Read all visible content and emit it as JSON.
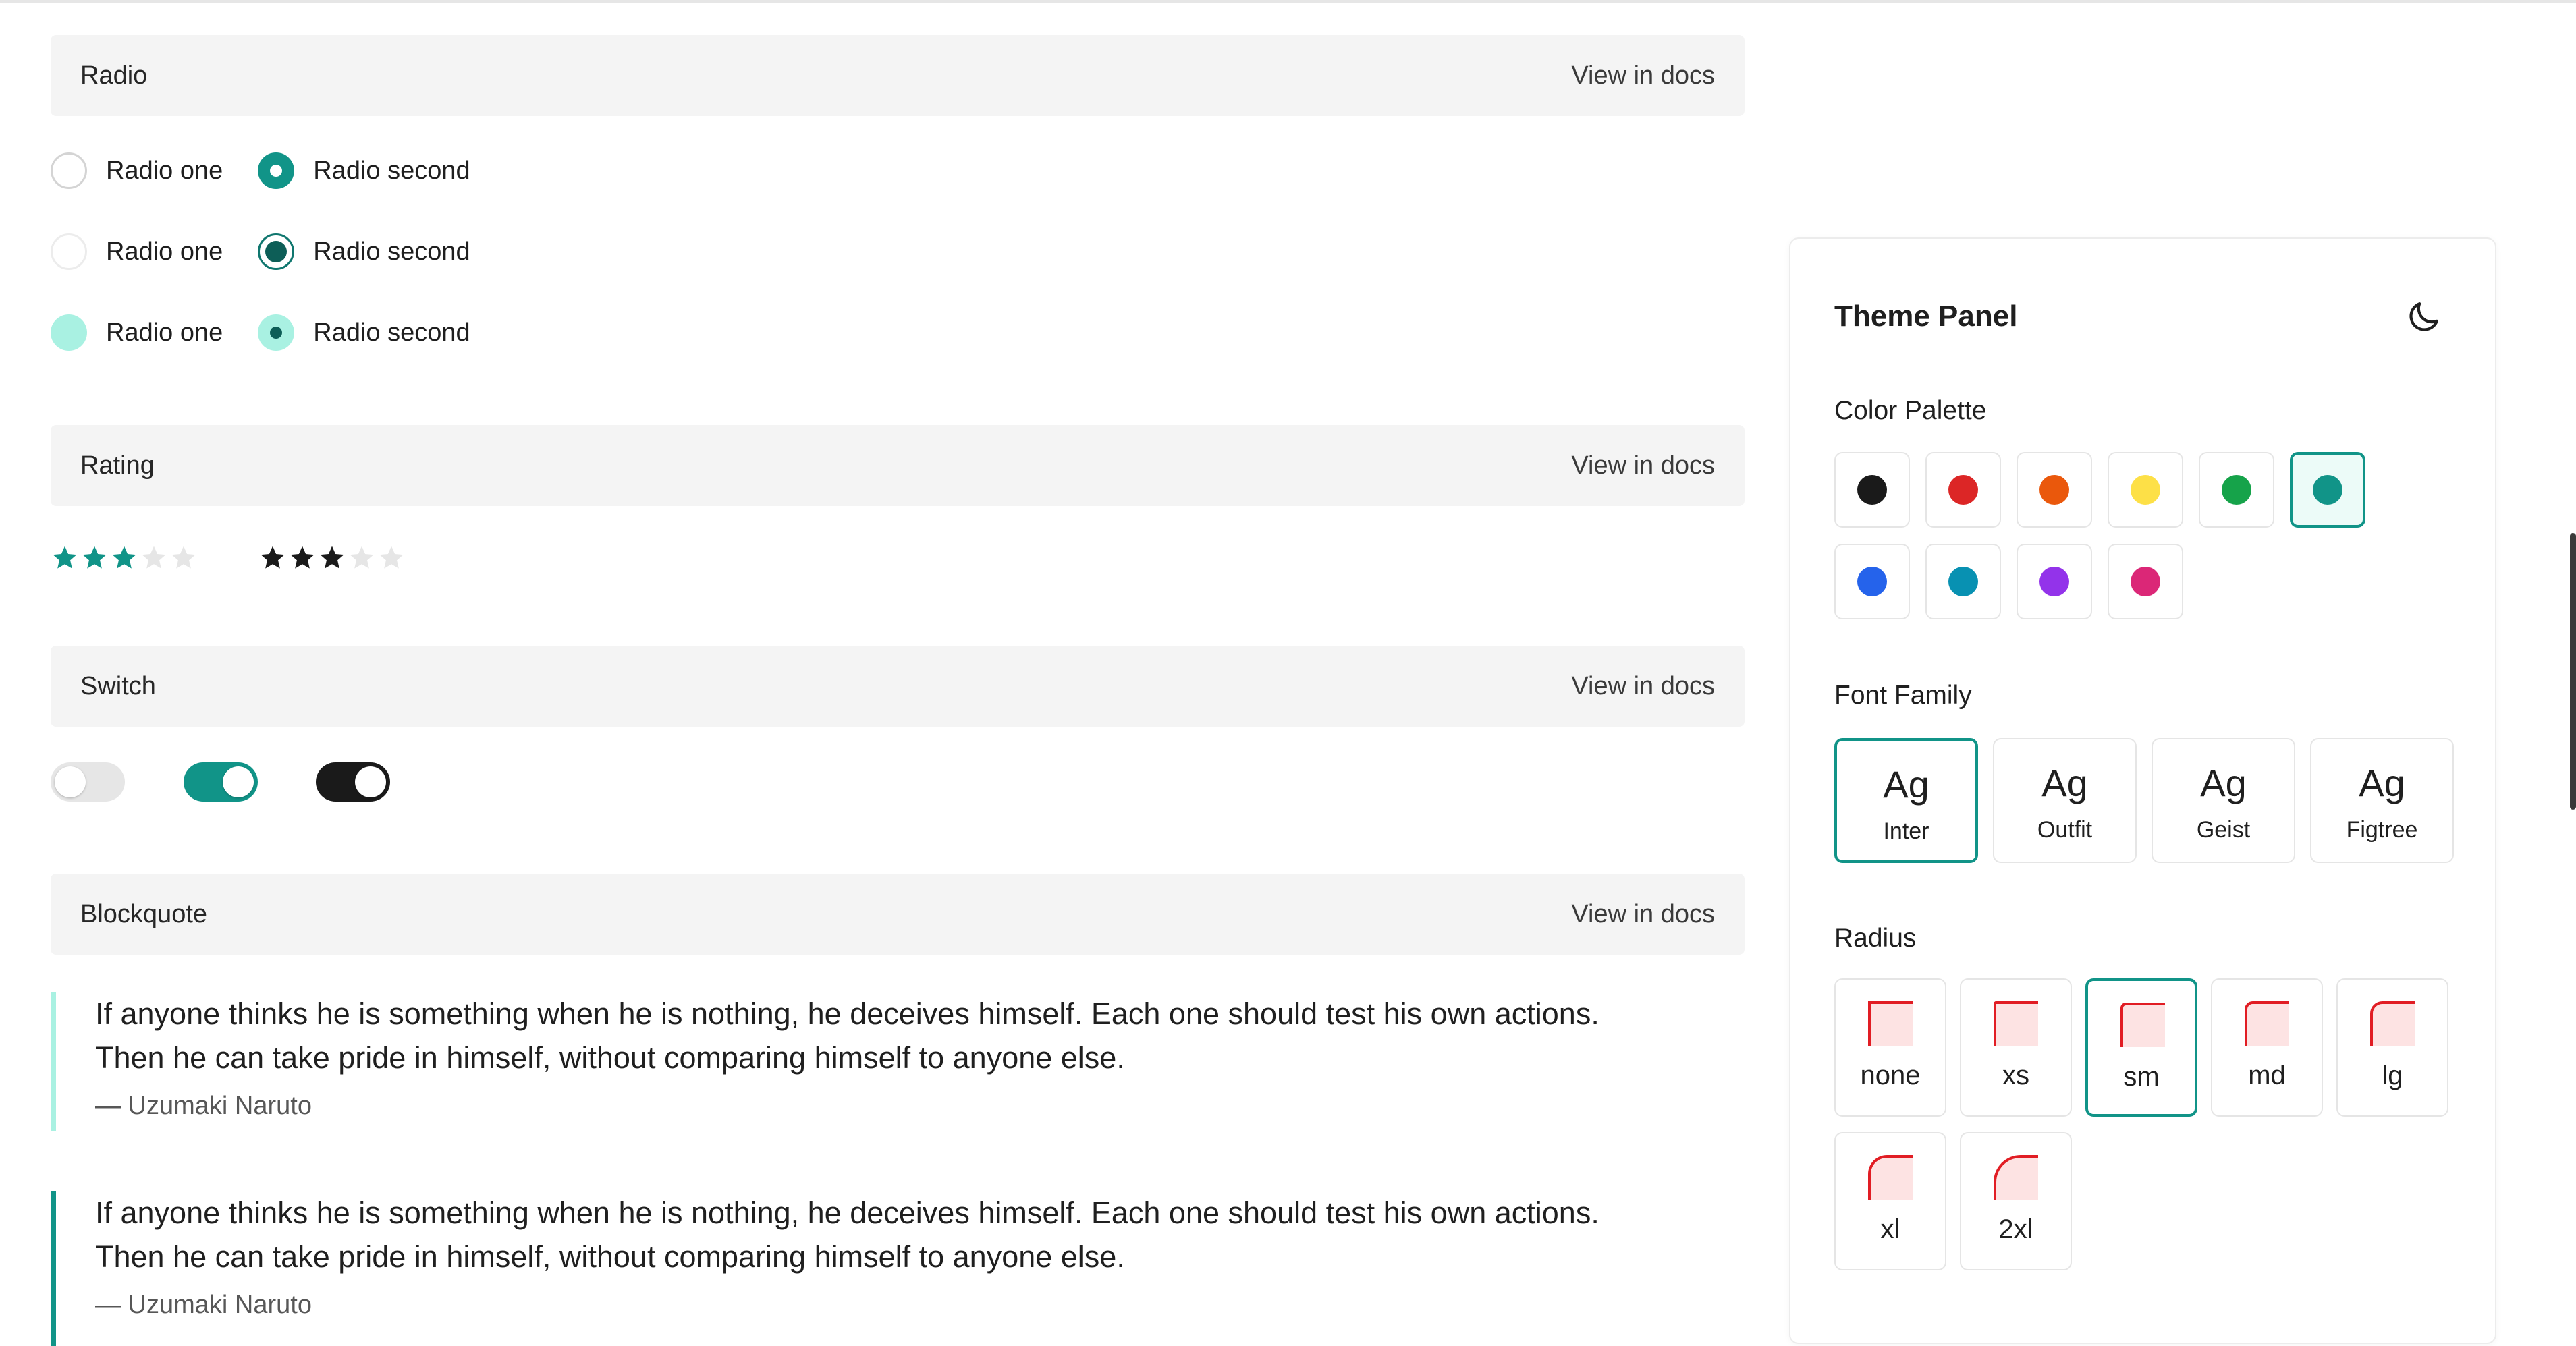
{
  "sections": {
    "radio": {
      "title": "Radio",
      "docs": "View in docs"
    },
    "rating": {
      "title": "Rating",
      "docs": "View in docs"
    },
    "switch": {
      "title": "Switch",
      "docs": "View in docs"
    },
    "blockquote": {
      "title": "Blockquote",
      "docs": "View in docs"
    }
  },
  "radio": {
    "rows": [
      {
        "first": "Radio one",
        "second": "Radio second"
      },
      {
        "first": "Radio one",
        "second": "Radio second"
      },
      {
        "first": "Radio one",
        "second": "Radio second"
      }
    ]
  },
  "rating": {
    "max": 5,
    "items": [
      {
        "value": 3,
        "color": "#119488"
      },
      {
        "value": 3,
        "color": "#1a1a1a"
      }
    ]
  },
  "switches": [
    {
      "on": false,
      "color": "#e6e6e6"
    },
    {
      "on": true,
      "color": "#119488"
    },
    {
      "on": true,
      "color": "#1a1a1a"
    }
  ],
  "blockquotes": [
    {
      "line1": "If anyone thinks he is something when he is nothing, he deceives himself. Each one should test his own actions.",
      "line2": "Then he can take pride in himself, without comparing himself to anyone else.",
      "author": "— Uzumaki Naruto",
      "bar_color": "#a9f1e2"
    },
    {
      "line1": "If anyone thinks he is something when he is nothing, he deceives himself. Each one should test his own actions.",
      "line2": "Then he can take pride in himself, without comparing himself to anyone else.",
      "author": "— Uzumaki Naruto",
      "bar_color": "#119488"
    }
  ],
  "theme_panel": {
    "title": "Theme Panel",
    "mode_icon": "moon-icon",
    "color_palette_label": "Color Palette",
    "colors": [
      {
        "name": "black",
        "hex": "#1a1a1a"
      },
      {
        "name": "red",
        "hex": "#dc2626"
      },
      {
        "name": "orange",
        "hex": "#ea580c"
      },
      {
        "name": "yellow",
        "hex": "#fde047"
      },
      {
        "name": "green",
        "hex": "#16a34a"
      },
      {
        "name": "teal",
        "hex": "#119488",
        "selected": true
      },
      {
        "name": "blue",
        "hex": "#2563eb"
      },
      {
        "name": "cyan",
        "hex": "#0891b2"
      },
      {
        "name": "purple",
        "hex": "#9333ea"
      },
      {
        "name": "pink",
        "hex": "#db2777"
      }
    ],
    "font_family_label": "Font Family",
    "fonts": [
      {
        "sample": "Ag",
        "name": "Inter",
        "selected": true
      },
      {
        "sample": "Ag",
        "name": "Outfit"
      },
      {
        "sample": "Ag",
        "name": "Geist"
      },
      {
        "sample": "Ag",
        "name": "Figtree"
      }
    ],
    "radius_label": "Radius",
    "radii": [
      {
        "name": "none",
        "corner": "0"
      },
      {
        "name": "xs",
        "corner": "4"
      },
      {
        "name": "sm",
        "corner": "8",
        "selected": true
      },
      {
        "name": "md",
        "corner": "12"
      },
      {
        "name": "lg",
        "corner": "18"
      },
      {
        "name": "xl",
        "corner": "28"
      },
      {
        "name": "2xl",
        "corner": "40"
      }
    ],
    "accent": "#119488"
  }
}
